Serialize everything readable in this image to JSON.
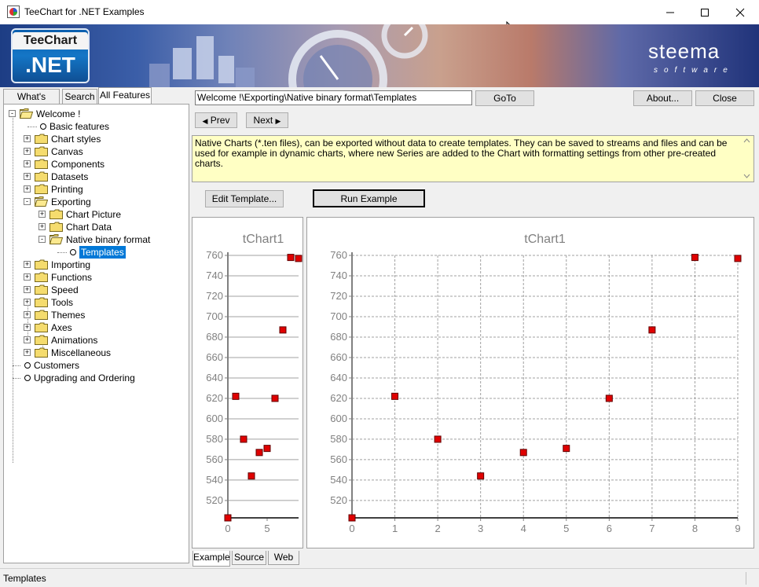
{
  "window": {
    "title": "TeeChart for .NET Examples"
  },
  "banner": {
    "logo_top": "TeeChart",
    "logo_bottom": ".NET",
    "brand": "steema",
    "brand_sub": "software"
  },
  "tabs": [
    {
      "label": "What's New?"
    },
    {
      "label": "Search"
    },
    {
      "label": "All Features"
    }
  ],
  "tree": [
    {
      "label": "Welcome !"
    },
    {
      "label": "Basic features"
    },
    {
      "label": "Chart styles"
    },
    {
      "label": "Canvas"
    },
    {
      "label": "Components"
    },
    {
      "label": "Datasets"
    },
    {
      "label": "Printing"
    },
    {
      "label": "Exporting"
    },
    {
      "label": "Chart Picture"
    },
    {
      "label": "Chart Data"
    },
    {
      "label": "Native binary format"
    },
    {
      "label": "Templates"
    },
    {
      "label": "Importing"
    },
    {
      "label": "Functions"
    },
    {
      "label": "Speed"
    },
    {
      "label": "Tools"
    },
    {
      "label": "Themes"
    },
    {
      "label": "Axes"
    },
    {
      "label": "Animations"
    },
    {
      "label": "Miscellaneous"
    },
    {
      "label": "Customers"
    },
    {
      "label": "Upgrading and Ordering"
    }
  ],
  "toolbar": {
    "path_value": "Welcome !\\Exporting\\Native binary format\\Templates",
    "goto_label": "GoTo",
    "about_label": "About...",
    "close_label": "Close",
    "prev_label": "Prev",
    "next_label": "Next"
  },
  "description": "Native Charts (*.ten files), can be exported without data to create templates. They can be saved to streams and files and can be used for example in dynamic charts, where new Series are added to the Chart with formatting settings from other pre-created charts.",
  "actions": {
    "edit_template_label": "Edit Template...",
    "run_example_label": "Run Example"
  },
  "bottom_tabs": [
    {
      "label": "Example"
    },
    {
      "label": "Source"
    },
    {
      "label": "Web"
    }
  ],
  "status": {
    "text": "Templates"
  },
  "colors": {
    "accent": "#0078d7",
    "point": "#e00000",
    "desc_bg": "#ffffc4"
  },
  "chart_data": [
    {
      "type": "scatter",
      "title": "tChart1",
      "x": [
        0,
        1,
        2,
        3,
        4,
        5,
        6,
        7,
        8,
        9
      ],
      "y": [
        503,
        622,
        580,
        544,
        567,
        571,
        620,
        687,
        758,
        757
      ],
      "ylim": [
        503,
        760
      ],
      "yticks": [
        520,
        540,
        560,
        580,
        600,
        620,
        640,
        660,
        680,
        700,
        720,
        740,
        760
      ],
      "xticks": [
        0,
        5
      ],
      "xlim": [
        0,
        9
      ],
      "grid": "horizontal"
    },
    {
      "type": "scatter",
      "title": "tChart1",
      "x": [
        0,
        1,
        2,
        3,
        4,
        5,
        6,
        7,
        8,
        9
      ],
      "y": [
        503,
        622,
        580,
        544,
        567,
        571,
        620,
        687,
        758,
        757
      ],
      "ylim": [
        503,
        760
      ],
      "yticks": [
        520,
        540,
        560,
        580,
        600,
        620,
        640,
        660,
        680,
        700,
        720,
        740,
        760
      ],
      "xticks": [
        0,
        1,
        2,
        3,
        4,
        5,
        6,
        7,
        8,
        9
      ],
      "xlim": [
        0,
        9
      ],
      "grid": "both-dashed"
    }
  ]
}
